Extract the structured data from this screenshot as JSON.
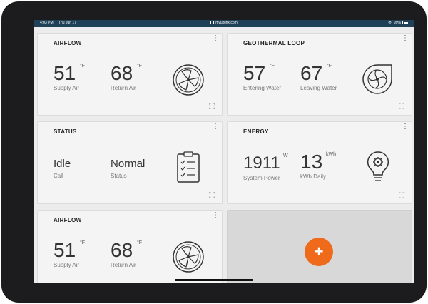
{
  "status_bar": {
    "time": "4:03 PM",
    "date": "Thu Jun 17",
    "url": "myuplink.com",
    "battery": "99%"
  },
  "cards": {
    "airflow1": {
      "title": "AIRFLOW",
      "supply": {
        "value": "51",
        "unit": "°F",
        "label": "Supply Air"
      },
      "ret": {
        "value": "68",
        "unit": "°F",
        "label": "Return Air"
      },
      "icon": "fan-icon"
    },
    "geothermal": {
      "title": "GEOTHERMAL LOOP",
      "entering": {
        "value": "57",
        "unit": "°F",
        "label": "Entering Water"
      },
      "leaving": {
        "value": "67",
        "unit": "°F",
        "label": "Leaving Water"
      },
      "icon": "pump-icon"
    },
    "status": {
      "title": "STATUS",
      "call": {
        "value": "Idle",
        "label": "Call"
      },
      "state": {
        "value": "Normal",
        "label": "Status"
      },
      "icon": "clipboard-icon"
    },
    "energy": {
      "title": "ENERGY",
      "power": {
        "value": "1911",
        "unit": "W",
        "label": "System Power"
      },
      "daily": {
        "value": "13",
        "unit": "kWh",
        "label": "kWh Daily"
      },
      "icon": "lightbulb-gear-icon"
    },
    "airflow2": {
      "title": "AIRFLOW",
      "supply": {
        "value": "51",
        "unit": "°F",
        "label": "Supply Air"
      },
      "ret": {
        "value": "68",
        "unit": "°F",
        "label": "Return Air"
      },
      "icon": "fan-icon"
    }
  },
  "add_button": {
    "label": "+"
  },
  "colors": {
    "status_bar": "#1e4157",
    "accent": "#ef6a1a",
    "card_bg": "#f4f4f4"
  }
}
